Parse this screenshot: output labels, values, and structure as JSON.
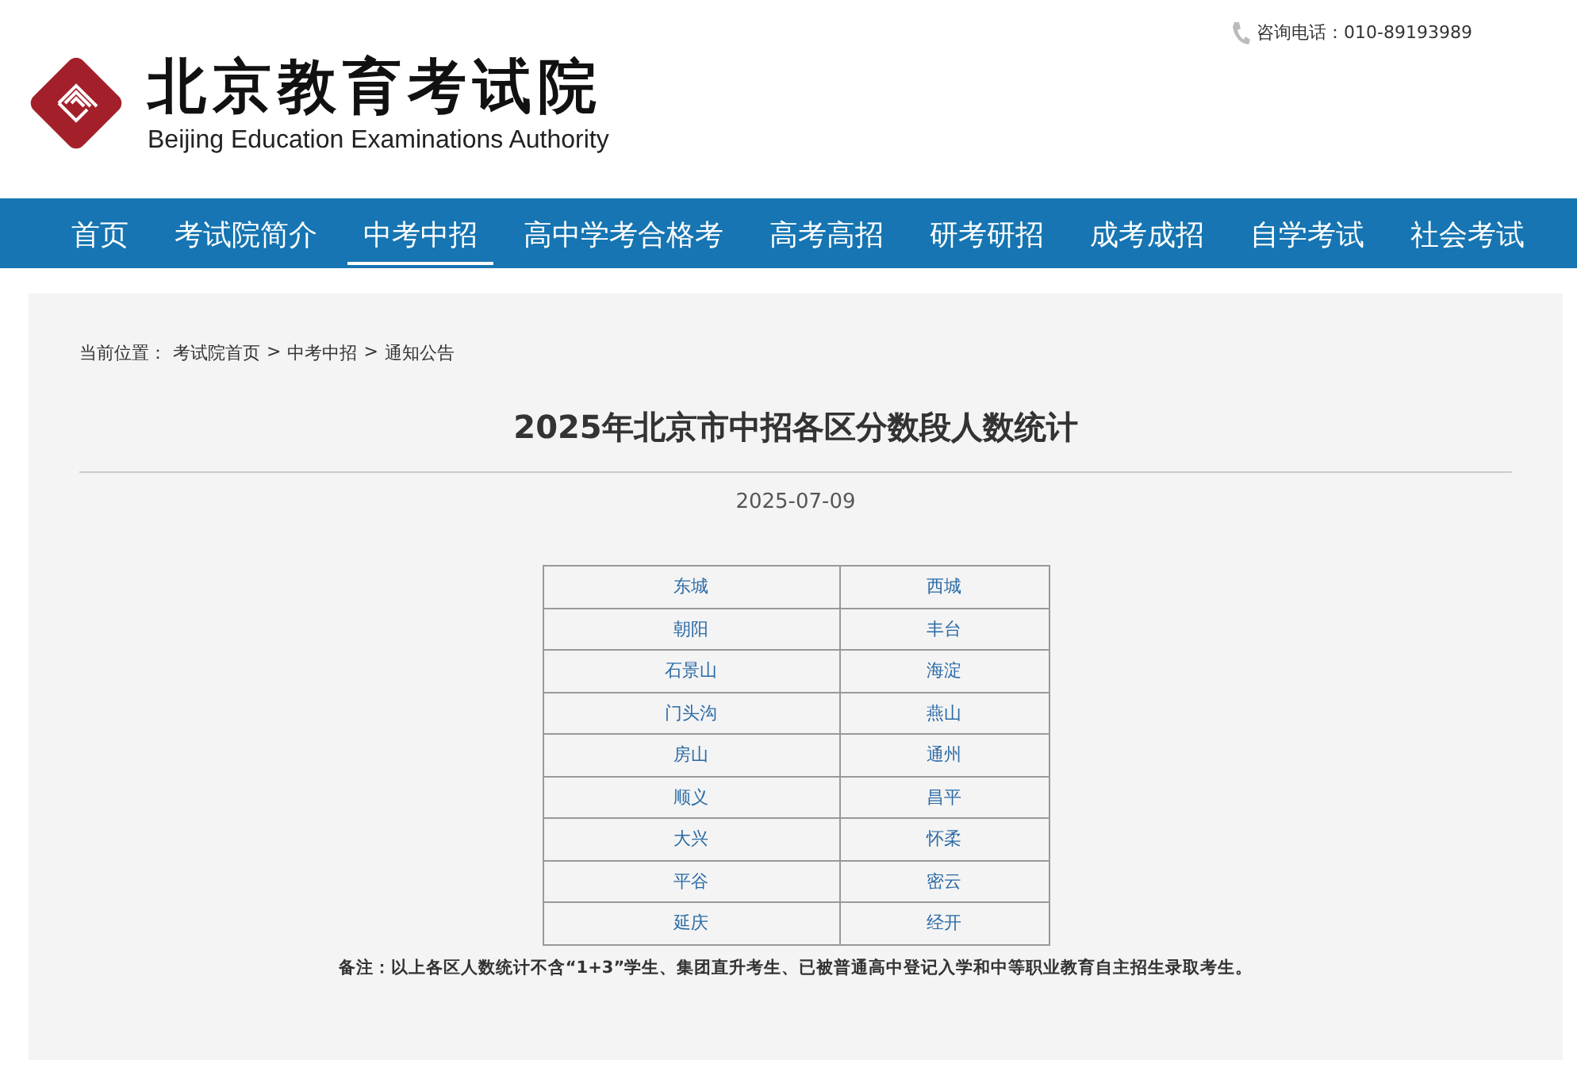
{
  "header": {
    "logo_title": "北京教育考试院",
    "logo_subtitle": "Beijing Education Examinations Authority",
    "hotline": "咨询电话：010-89193989"
  },
  "nav": [
    {
      "label": "首页",
      "selected": false
    },
    {
      "label": "考试院简介",
      "selected": false
    },
    {
      "label": "中考中招",
      "selected": true
    },
    {
      "label": "高中学考合格考",
      "selected": false
    },
    {
      "label": "高考高招",
      "selected": false
    },
    {
      "label": "研考研招",
      "selected": false
    },
    {
      "label": "成考成招",
      "selected": false
    },
    {
      "label": "自学考试",
      "selected": false
    },
    {
      "label": "社会考试",
      "selected": false
    }
  ],
  "breadcrumb": {
    "label": "当前位置：",
    "links": [
      "考试院首页",
      "中考中招",
      "通知公告"
    ],
    "separators": [
      ">",
      ">"
    ]
  },
  "article": {
    "title": "2025年北京市中招各区分数段人数统计",
    "date": "2025-07-09",
    "table_rows": [
      [
        "东城",
        "西城"
      ],
      [
        "朝阳",
        "丰台"
      ],
      [
        "石景山",
        "海淀"
      ],
      [
        "门头沟",
        "燕山"
      ],
      [
        "房山",
        "通州"
      ],
      [
        "顺义",
        "昌平"
      ],
      [
        "大兴",
        "怀柔"
      ],
      [
        "平谷",
        "密云"
      ],
      [
        "延庆",
        "经开"
      ]
    ],
    "note": "备注：以上各区人数统计不含“1+3”学生、集团直升考生、已被普通高中登记入学和中等职业教育自主招生录取考生。"
  }
}
